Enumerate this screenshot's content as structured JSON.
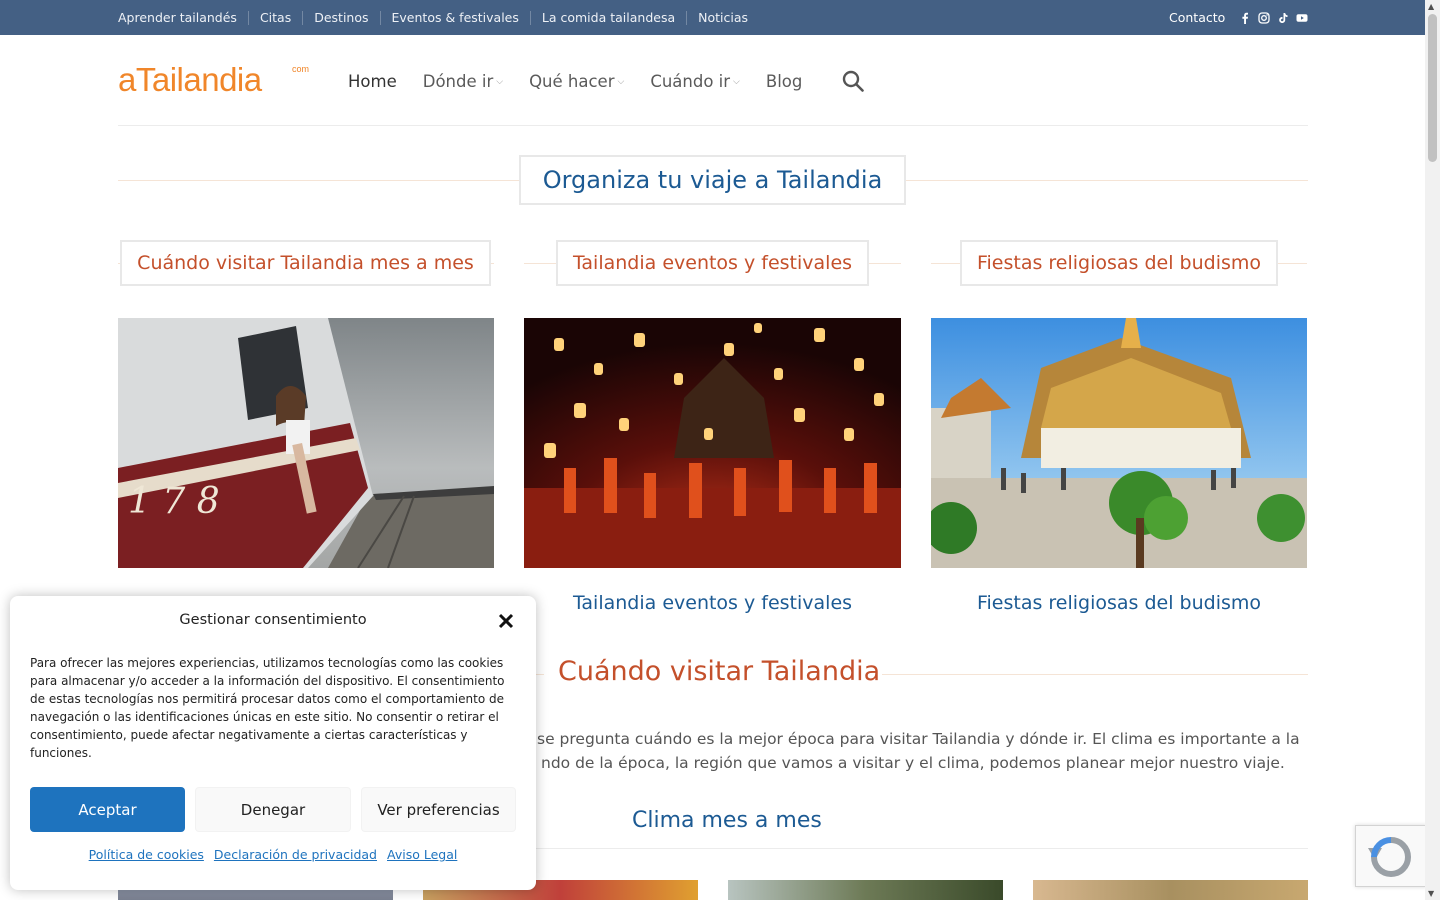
{
  "topbar": {
    "links": [
      "Aprender tailandés",
      "Citas",
      "Destinos",
      "Eventos & festivales",
      "La comida tailandesa",
      "Noticias"
    ],
    "contact": "Contacto",
    "social_icons": [
      "facebook-icon",
      "instagram-icon",
      "tiktok-icon",
      "youtube-icon"
    ],
    "bg_color": "#446084"
  },
  "header": {
    "logo_main": "aTailandia",
    "logo_suffix": "com",
    "nav": [
      {
        "label": "Home"
      },
      {
        "label": "Dónde ir"
      },
      {
        "label": "Qué hacer"
      },
      {
        "label": "Cuándo ir"
      },
      {
        "label": "Blog"
      }
    ],
    "search_icon": "search-icon"
  },
  "main": {
    "section_title": "Organiza tu viaje a Tailandia",
    "columns": [
      {
        "title": "Cuándo visitar Tailandia mes a mes",
        "image": "train-window-woman-photo",
        "caption": ""
      },
      {
        "title": "Tailandia eventos y festivales",
        "image": "lantern-festival-photo",
        "caption": "Tailandia eventos y festivales"
      },
      {
        "title": "Fiestas religiosas del budismo",
        "image": "thai-temple-photo",
        "caption": "Fiestas religiosas del budismo"
      }
    ],
    "cuando_heading": "Cuándo visitar Tailandia",
    "paragraph": "se pregunta cuándo es la mejor época para visitar Tailandia y dónde ir. El clima es importante a la ndo de la época, la región que vamos a visitar y el clima, podemos planear mejor nuestro viaje.",
    "paragraph_lines": [
      "se pregunta cuándo es la mejor época para visitar Tailandia y dónde ir. El clima es importante a la",
      "ndo de la época, la región que vamos a visitar y el clima, podemos planear mejor nuestro viaje."
    ],
    "clima_heading": "Clima mes a mes"
  },
  "consent": {
    "title": "Gestionar consentimiento",
    "text": "Para ofrecer las mejores experiencias, utilizamos tecnologías como las cookies para almacenar y/o acceder a la información del dispositivo. El consentimiento de estas tecnologías nos permitirá procesar datos como el comportamiento de navegación o las identificaciones únicas en este sitio. No consentir o retirar el consentimiento, puede afectar negativamente a ciertas características y funciones.",
    "accept": "Aceptar",
    "deny": "Denegar",
    "preferences": "Ver preferencias",
    "links": [
      "Política de cookies",
      "Declaración de privacidad",
      "Aviso Legal"
    ],
    "accent_color": "#1e73be"
  },
  "colors": {
    "orange_heading": "#c4502b",
    "blue_heading": "#1c5a93",
    "logo": "#f0862a"
  }
}
